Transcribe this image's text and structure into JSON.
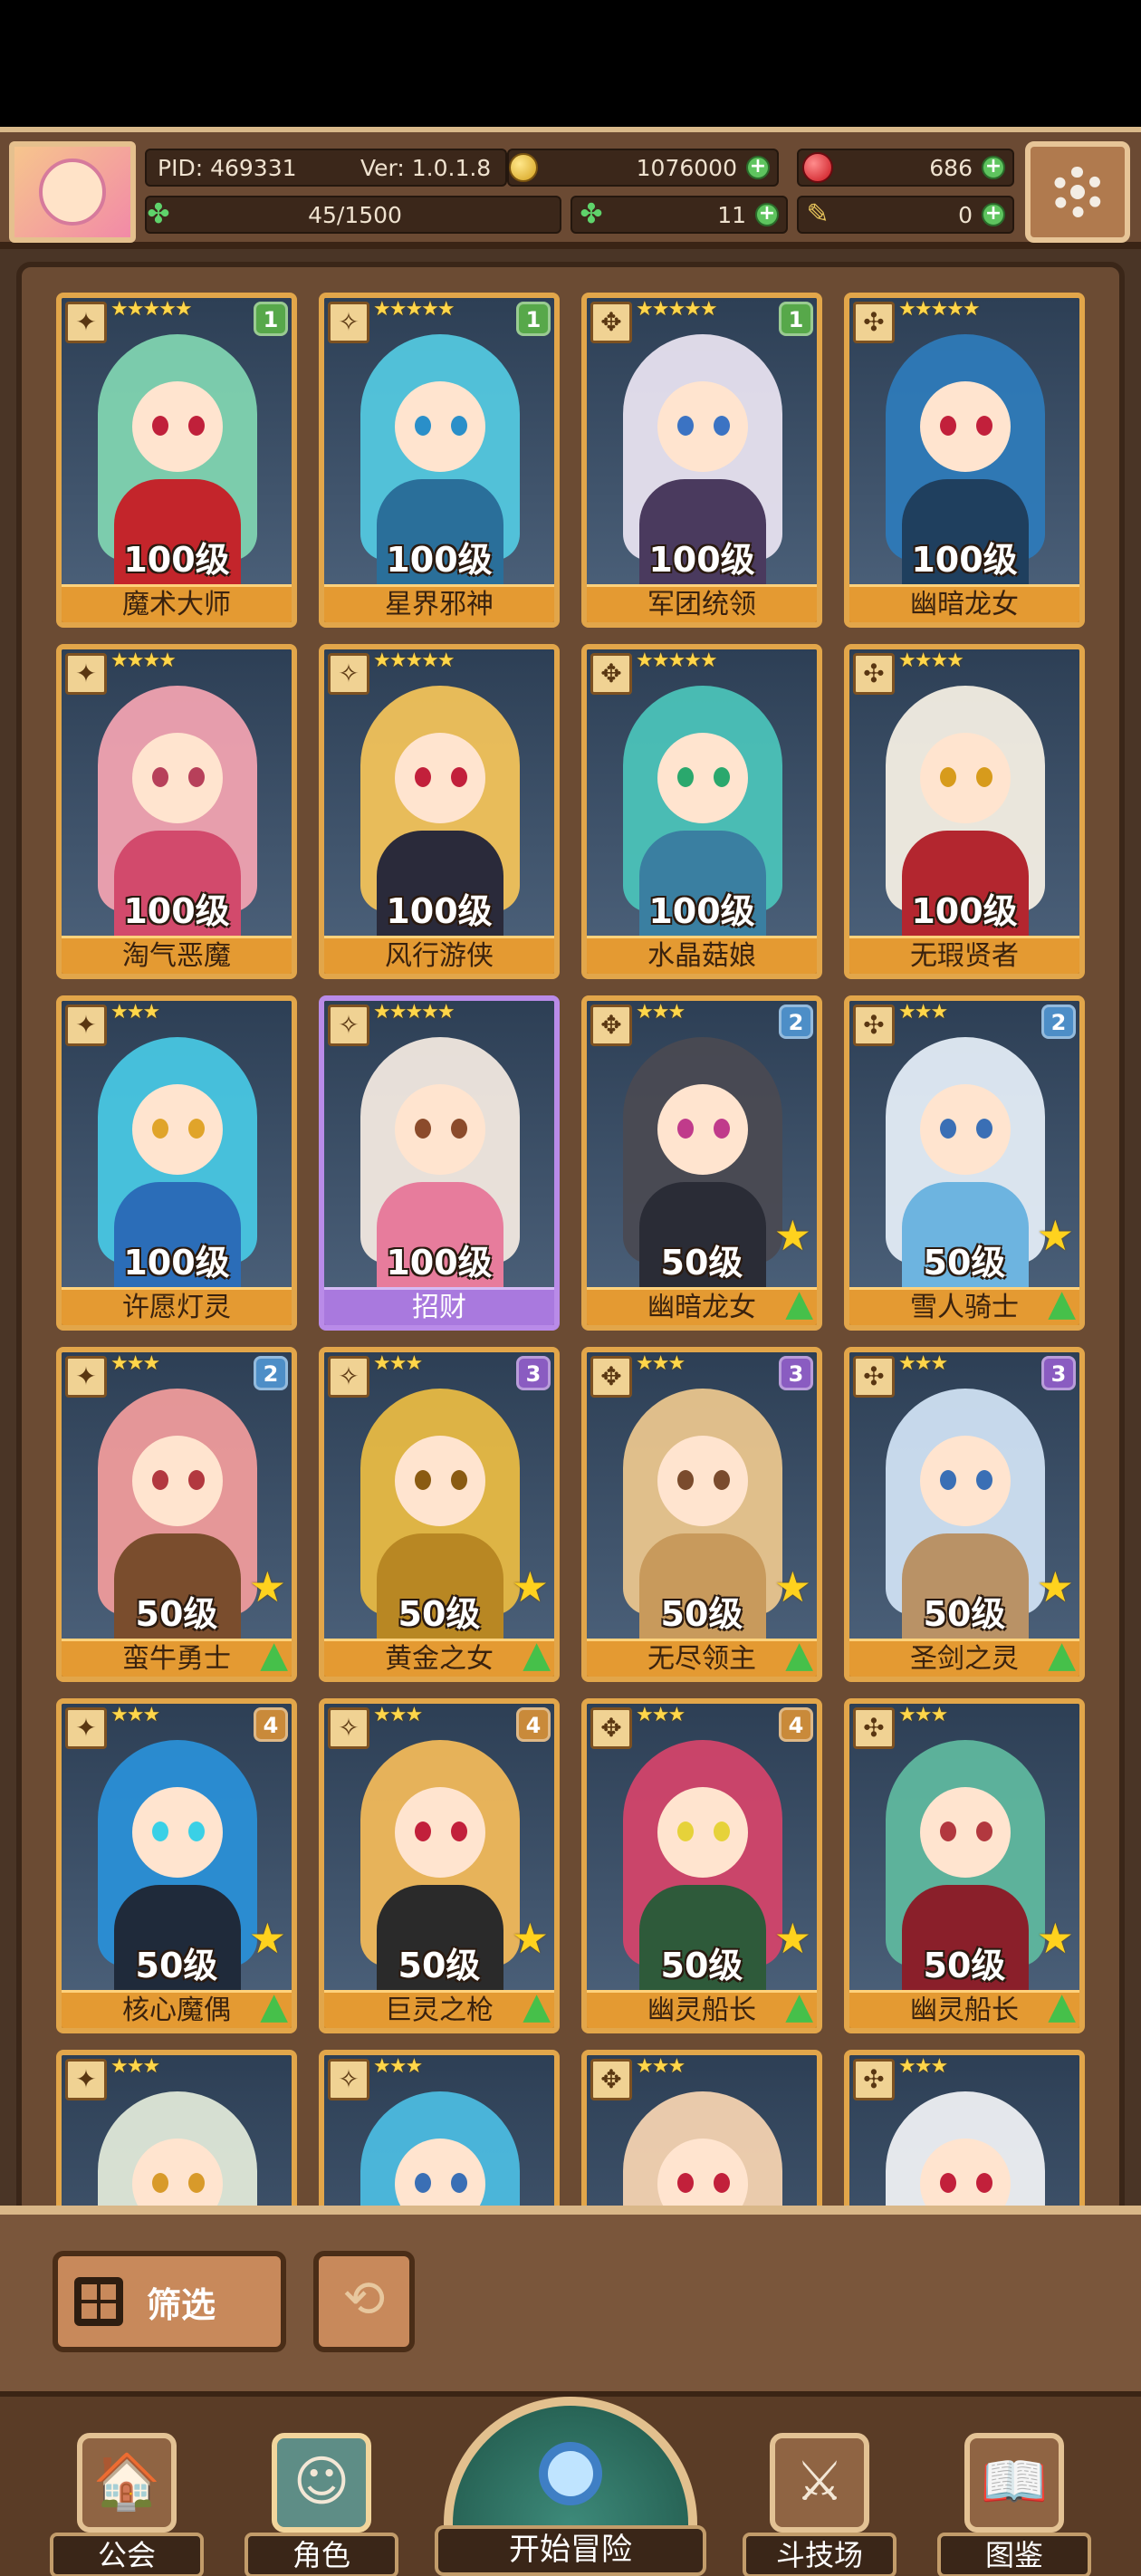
{
  "header": {
    "pid": "PID: 469331",
    "version": "Ver: 1.0.1.8",
    "gold": "1076000",
    "gems": "686",
    "stamina": "45/1500",
    "clover": "11",
    "feather": "0"
  },
  "cards": [
    {
      "level": "100级",
      "name": "魔术大师",
      "stars": "★★★★★",
      "badge": "1",
      "badge_color": "#57a84a",
      "frame": "gold",
      "hair": "#7fd3b0",
      "body": "#c3252b",
      "eye": "#c0203a",
      "up": false
    },
    {
      "level": "100级",
      "name": "星界邪神",
      "stars": "★★★★★",
      "badge": "1",
      "badge_color": "#57a84a",
      "frame": "gold",
      "hair": "#53c7de",
      "body": "#2a6f9a",
      "eye": "#2a8fc9",
      "up": false
    },
    {
      "level": "100级",
      "name": "军团统领",
      "stars": "★★★★★",
      "badge": "1",
      "badge_color": "#57a84a",
      "frame": "gold",
      "hair": "#e7e2ef",
      "body": "#4a3a5e",
      "eye": "#3b73c3",
      "up": false
    },
    {
      "level": "100级",
      "name": "幽暗龙女",
      "stars": "★★★★★",
      "badge": "",
      "badge_color": "",
      "frame": "gold",
      "hair": "#2e7ab8",
      "body": "#1f3f5e",
      "eye": "#c2203b",
      "up": false
    },
    {
      "level": "100级",
      "name": "淘气恶魔",
      "stars": "★★★★",
      "badge": "",
      "badge_color": "",
      "frame": "gold",
      "hair": "#f0a2b0",
      "body": "#d24a6c",
      "eye": "#b7405a",
      "up": false
    },
    {
      "level": "100级",
      "name": "风行游侠",
      "stars": "★★★★★",
      "badge": "",
      "badge_color": "",
      "frame": "gold",
      "hair": "#f1c25a",
      "body": "#2a2a3a",
      "eye": "#c2203b",
      "up": false
    },
    {
      "level": "100级",
      "name": "水晶菇娘",
      "stars": "★★★★★",
      "badge": "",
      "badge_color": "",
      "frame": "gold",
      "hair": "#4bc2b8",
      "body": "#3a7fa1",
      "eye": "#2aa86d",
      "up": false
    },
    {
      "level": "100级",
      "name": "无瑕贤者",
      "stars": "★★★★",
      "badge": "",
      "badge_color": "",
      "frame": "gold",
      "hair": "#f3eee3",
      "body": "#b3262f",
      "eye": "#d79b1c",
      "up": false
    },
    {
      "level": "100级",
      "name": "许愿灯灵",
      "stars": "★★★",
      "badge": "",
      "badge_color": "",
      "frame": "gold",
      "hair": "#48c6e2",
      "body": "#2b6db8",
      "eye": "#e0a42a",
      "up": false
    },
    {
      "level": "100级",
      "name": "招财",
      "stars": "★★★★★",
      "badge": "",
      "badge_color": "",
      "frame": "purple",
      "hair": "#f1e8df",
      "body": "#e77c9c",
      "eye": "#8b4b2b",
      "up": false
    },
    {
      "level": "50级",
      "name": "幽暗龙女",
      "stars": "★★★",
      "badge": "2",
      "badge_color": "#4d8ec7",
      "frame": "gold",
      "hair": "#4a4a52",
      "body": "#2a2c36",
      "eye": "#c03b8b",
      "up": true
    },
    {
      "level": "50级",
      "name": "雪人骑士",
      "stars": "★★★",
      "badge": "2",
      "badge_color": "#4d8ec7",
      "frame": "gold",
      "hair": "#e3ecf6",
      "body": "#6db4e0",
      "eye": "#3a6fb5",
      "up": true
    },
    {
      "level": "50级",
      "name": "蛮牛勇士",
      "stars": "★★★",
      "badge": "2",
      "badge_color": "#4d8ec7",
      "frame": "gold",
      "hair": "#ee9b9b",
      "body": "#7a4d2d",
      "eye": "#b2383f",
      "up": true
    },
    {
      "level": "50级",
      "name": "黄金之女",
      "stars": "★★★",
      "badge": "3",
      "badge_color": "#8a5cc1",
      "frame": "gold",
      "hair": "#e7b943",
      "body": "#b88723",
      "eye": "#8a5b12",
      "up": true
    },
    {
      "level": "50级",
      "name": "无尽领主",
      "stars": "★★★",
      "badge": "3",
      "badge_color": "#8a5cc1",
      "frame": "gold",
      "hair": "#e9c58d",
      "body": "#c89a5c",
      "eye": "#7a4b2d",
      "up": true
    },
    {
      "level": "50级",
      "name": "圣剑之灵",
      "stars": "★★★",
      "badge": "3",
      "badge_color": "#8a5cc1",
      "frame": "gold",
      "hair": "#cfe0f2",
      "body": "#b99266",
      "eye": "#3a6fb5",
      "up": true
    },
    {
      "level": "50级",
      "name": "核心魔偶",
      "stars": "★★★",
      "badge": "4",
      "badge_color": "#c98a3a",
      "frame": "gold",
      "hair": "#2a8fd6",
      "body": "#1f2a3a",
      "eye": "#3ad0e6",
      "up": true
    },
    {
      "level": "50级",
      "name": "巨灵之枪",
      "stars": "★★★",
      "badge": "4",
      "badge_color": "#c98a3a",
      "frame": "gold",
      "hair": "#f0b85a",
      "body": "#2a2a2a",
      "eye": "#c2203b",
      "up": true
    },
    {
      "level": "50级",
      "name": "幽灵船长",
      "stars": "★★★",
      "badge": "4",
      "badge_color": "#c98a3a",
      "frame": "gold",
      "hair": "#d2446a",
      "body": "#2e5a3a",
      "eye": "#e6d23a",
      "up": true
    },
    {
      "level": "50级",
      "name": "幽灵船长",
      "stars": "★★★",
      "badge": "",
      "badge_color": "",
      "frame": "gold",
      "hair": "#5fb79e",
      "body": "#8a1f2a",
      "eye": "#b2383f",
      "up": true
    },
    {
      "level": "",
      "name": "",
      "stars": "★★★",
      "badge": "",
      "badge_color": "",
      "frame": "gold",
      "hair": "#dfe8d8",
      "body": "#8fb08a",
      "eye": "#d89a2a",
      "up": false
    },
    {
      "level": "",
      "name": "",
      "stars": "★★★",
      "badge": "",
      "badge_color": "",
      "frame": "gold",
      "hair": "#4cbadf",
      "body": "#3a7fa1",
      "eye": "#3a6fb5",
      "up": false
    },
    {
      "level": "",
      "name": "",
      "stars": "★★★",
      "badge": "",
      "badge_color": "",
      "frame": "gold",
      "hair": "#f3d2b0",
      "body": "#3a2a2a",
      "eye": "#c2203b",
      "up": false
    },
    {
      "level": "",
      "name": "",
      "stars": "★★★",
      "badge": "",
      "badge_color": "",
      "frame": "gold",
      "hair": "#eef0f3",
      "body": "#7a3a2a",
      "eye": "#c2203b",
      "up": false
    }
  ],
  "filter": {
    "label": "筛选"
  },
  "nav": {
    "guild": "公会",
    "character": "角色",
    "adventure": "开始冒险",
    "arena": "斗技场",
    "codex": "图鉴"
  }
}
